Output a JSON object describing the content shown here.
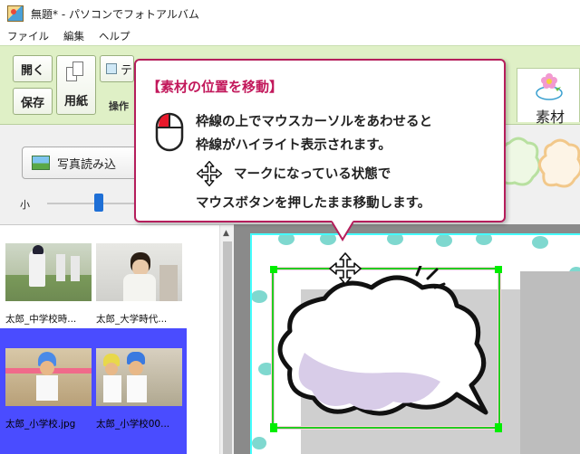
{
  "window": {
    "title": "無題* - パソコンでフォトアルバム"
  },
  "menu": {
    "items": [
      "ファイル",
      "編集",
      "ヘルプ"
    ]
  },
  "ribbon": {
    "open_label": "開く",
    "save_label": "保存",
    "paper_label": "用紙",
    "text_partial": "テ",
    "operation_label": "操作",
    "sozai_label": "素材"
  },
  "toolbar": {
    "photo_load_label": "写真読み込",
    "size_small_label": "小"
  },
  "photos": [
    {
      "name": "太郎_中学校時..."
    },
    {
      "name": "太郎_大学時代..."
    },
    {
      "name": "太郎_小学校.jpg"
    },
    {
      "name": "太郎_小学校00..."
    }
  ],
  "callout": {
    "title": "【素材の位置を移動】",
    "line1": "枠線の上でマウスカーソルをあわせると",
    "line2": "枠線がハイライト表示されます。",
    "line3": "マークになっている状態で",
    "line4": "マウスボタンを押したまま移動します。"
  },
  "colors": {
    "accent": "#c2185b",
    "selection": "#4a4cff",
    "frame_highlight": "#22cc22",
    "ribbon_bg": "#dff0c6"
  }
}
